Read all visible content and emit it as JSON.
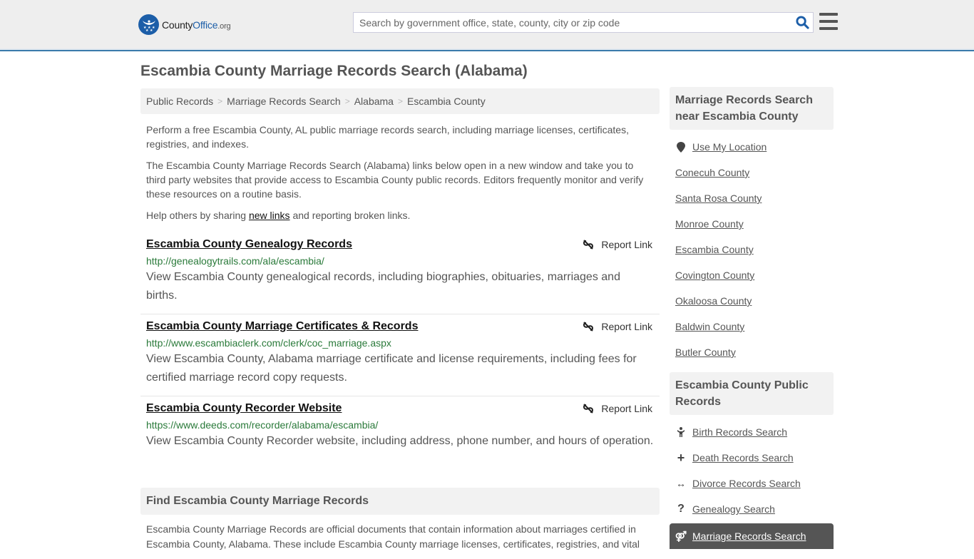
{
  "header": {
    "logo": {
      "county": "County",
      "office": "Office",
      "org": ".org"
    },
    "search_placeholder": "Search by government office, state, county, city or zip code",
    "search_icon": "search-icon",
    "menu_icon": "hamburger-menu-icon"
  },
  "page_title": "Escambia County Marriage Records Search (Alabama)",
  "breadcrumb": [
    "Public Records",
    "Marriage Records Search",
    "Alabama",
    "Escambia County"
  ],
  "intro": {
    "p1": "Perform a free Escambia County, AL public marriage records search, including marriage licenses, certificates, registries, and indexes.",
    "p2": "The Escambia County Marriage Records Search (Alabama) links below open in a new window and take you to third party websites that provide access to Escambia County public records. Editors frequently monitor and verify these resources on a routine basis.",
    "p3_before": "Help others by sharing ",
    "p3_link": "new links",
    "p3_after": " and reporting broken links."
  },
  "results": [
    {
      "title": "Escambia County Genealogy Records",
      "url": "http://genealogytrails.com/ala/escambia/",
      "description": "View Escambia County genealogical records, including biographies, obituaries, marriages and births.",
      "report_label": "Report Link"
    },
    {
      "title": "Escambia County Marriage Certificates & Records",
      "url": "http://www.escambiaclerk.com/clerk/coc_marriage.aspx",
      "description": "View Escambia County, Alabama marriage certificate and license requirements, including fees for certified marriage record copy requests.",
      "report_label": "Report Link"
    },
    {
      "title": "Escambia County Recorder Website",
      "url": "https://www.deeds.com/recorder/alabama/escambia/",
      "description": "View Escambia County Recorder website, including address, phone number, and hours of operation.",
      "report_label": "Report Link"
    }
  ],
  "find_section": {
    "heading": "Find Escambia County Marriage Records",
    "body": "Escambia County Marriage Records are official documents that contain information about marriages certified in Escambia County, Alabama. These include Escambia County marriage licenses, certificates, registries, and vital"
  },
  "sidebar": {
    "nearby_heading": "Marriage Records Search near Escambia County",
    "use_location": "Use My Location",
    "nearby": [
      "Conecuh County",
      "Santa Rosa County",
      "Monroe County",
      "Escambia County",
      "Covington County",
      "Okaloosa County",
      "Baldwin County",
      "Butler County"
    ],
    "public_heading": "Escambia County Public Records",
    "public_links": [
      {
        "label": "Birth Records Search",
        "icon": "child-icon"
      },
      {
        "label": "Death Records Search",
        "icon": "plus-icon"
      },
      {
        "label": "Divorce Records Search",
        "icon": "arrows-horizontal-icon"
      },
      {
        "label": "Genealogy Search",
        "icon": "question-icon"
      }
    ],
    "active_link": {
      "label": "Marriage Records Search",
      "icon": "marriage-icon"
    }
  }
}
